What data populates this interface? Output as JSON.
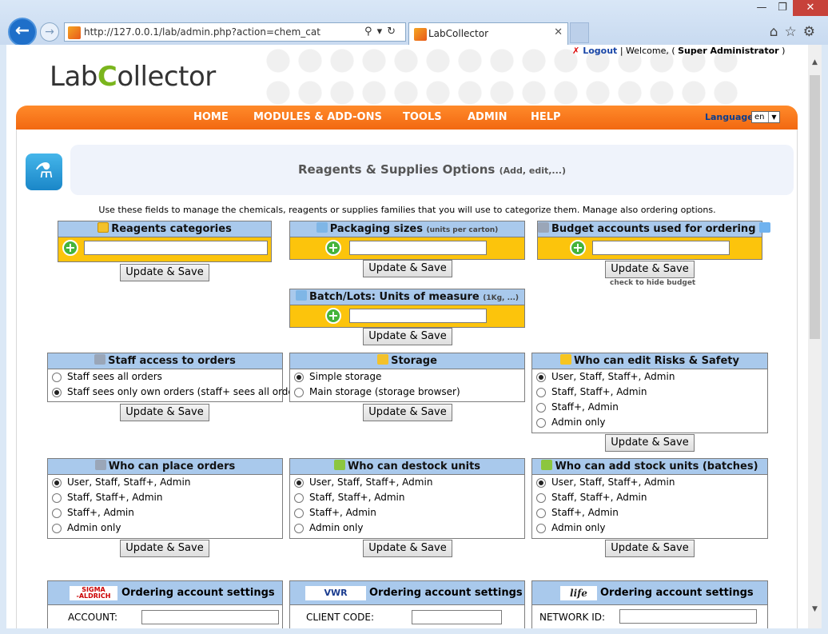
{
  "browser": {
    "url": "http://127.0.0.1/lab/admin.php?action=chem_cat",
    "tab_title": "LabCollector",
    "window_controls": [
      "minimize-icon",
      "restore-icon",
      "close-icon"
    ],
    "toolbar_icons": [
      "home-icon",
      "star-icon",
      "gear-icon"
    ]
  },
  "header": {
    "logo_text_1": "Lab",
    "logo_text_2": "C",
    "logo_text_3": "ollector",
    "logout_label": "Logout",
    "welcome_prefix": "| Welcome, (",
    "user_name": "Super Administrator",
    "welcome_suffix": ")"
  },
  "menu": {
    "items": [
      "HOME",
      "MODULES & ADD-ONS",
      "TOOLS",
      "ADMIN",
      "HELP"
    ],
    "language_label": "Language:",
    "language_value": "en"
  },
  "page": {
    "title": "Reagents & Supplies Options",
    "title_sub": "(Add, edit,...)",
    "intro": "Use these fields to manage the chemicals, reagents or supplies families that you will use to categorize them. Manage also ordering options."
  },
  "update_label": "Update & Save",
  "boxes": {
    "reagents_categories": {
      "title": "Reagents categories"
    },
    "packaging_sizes": {
      "title": "Packaging sizes",
      "small": "(units per carton)"
    },
    "budget_accounts": {
      "title": "Budget accounts used for ordering",
      "hint": "check to hide budget"
    },
    "batch_units": {
      "title": "Batch/Lots: Units of measure",
      "small": "(1Kg, ...)"
    },
    "staff_access": {
      "title": "Staff access to orders",
      "options": [
        "Staff sees all orders",
        "Staff sees only own orders (staff+ sees all orders)"
      ],
      "selected": 1
    },
    "storage": {
      "title": "Storage",
      "options": [
        "Simple storage",
        "Main storage (storage browser)"
      ],
      "selected": 0
    },
    "risks_safety": {
      "title": "Who can edit Risks & Safety",
      "options": [
        "User, Staff, Staff+, Admin",
        "Staff, Staff+, Admin",
        "Staff+, Admin",
        "Admin only"
      ],
      "selected": 0
    },
    "place_orders": {
      "title": "Who can place orders",
      "options": [
        "User, Staff, Staff+, Admin",
        "Staff, Staff+, Admin",
        "Staff+, Admin",
        "Admin only"
      ],
      "selected": 0
    },
    "destock_units": {
      "title": "Who can destock units",
      "options": [
        "User, Staff, Staff+, Admin",
        "Staff, Staff+, Admin",
        "Staff+, Admin",
        "Admin only"
      ],
      "selected": 0
    },
    "add_stock": {
      "title": "Who can add stock units (batches)",
      "options": [
        "User, Staff, Staff+, Admin",
        "Staff, Staff+, Admin",
        "Staff+, Admin",
        "Admin only"
      ],
      "selected": 0
    }
  },
  "ordering": {
    "title": "Ordering account settings",
    "sigma": {
      "logo_1": "SIGMA",
      "logo_2": "-ALDRICH",
      "field_label": "ACCOUNT:"
    },
    "vwr": {
      "logo": "VWR",
      "field_label": "CLIENT CODE:"
    },
    "life": {
      "logo": "life",
      "field_label": "NETWORK ID:"
    }
  },
  "colors": {
    "menu_orange": "#f26811",
    "box_header_blue": "#a9c9ec",
    "box_yellow": "#fcc40c",
    "logo_green": "#7ab51d"
  }
}
